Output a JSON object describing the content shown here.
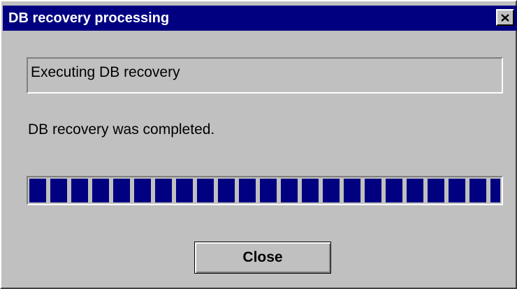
{
  "window": {
    "title": "DB recovery processing"
  },
  "status_box": {
    "text": "Executing DB recovery"
  },
  "message": {
    "text": "DB recovery was completed."
  },
  "progress": {
    "percent": 100
  },
  "buttons": {
    "close_label": "Close"
  },
  "icons": {
    "title_close": "close-icon"
  },
  "colors": {
    "title_bar": "#000080",
    "progress_fill": "#000080",
    "window_face": "#c0c0c0"
  }
}
